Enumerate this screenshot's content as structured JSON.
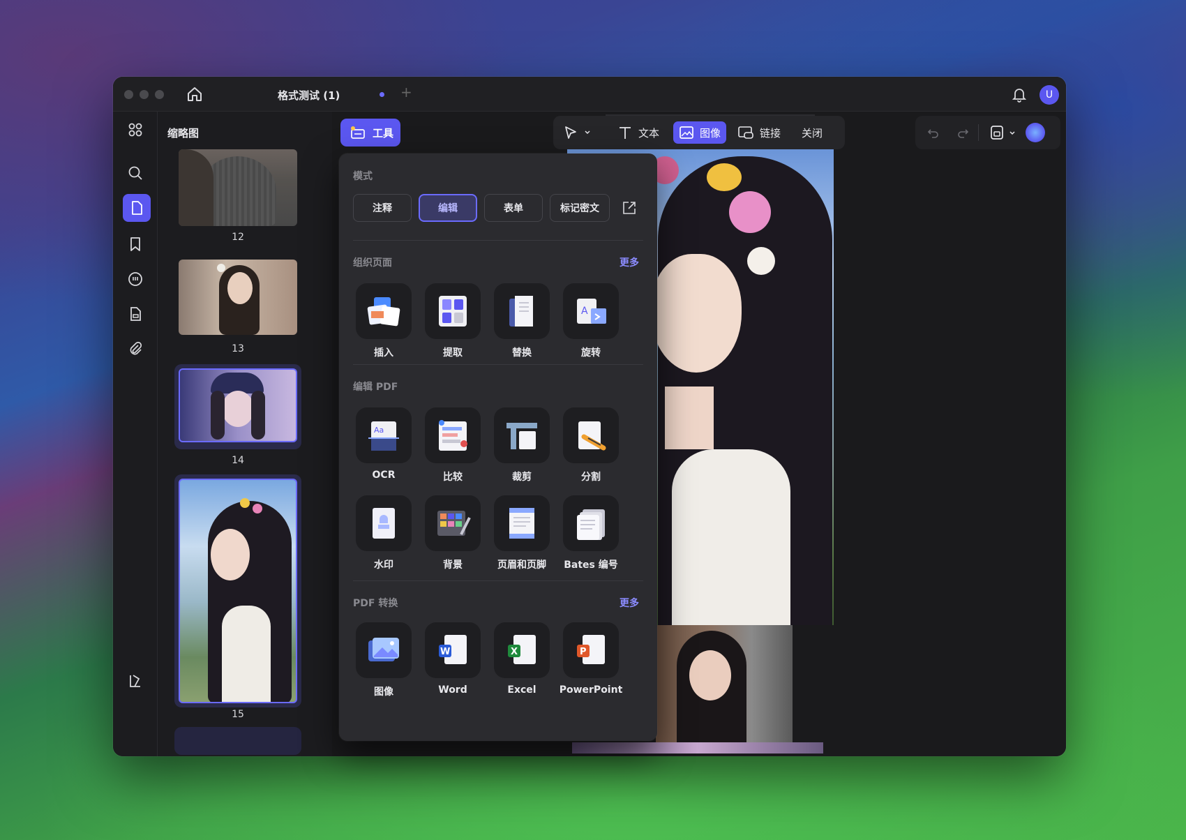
{
  "window": {
    "tab_title": "格式测试 (1)",
    "avatar_letter": "U"
  },
  "sidebar": {
    "panel_title": "缩略图",
    "rail_icons": [
      "grid-icon",
      "search-icon",
      "page-icon",
      "bookmark-icon",
      "comment-icon",
      "form-icon",
      "attachment-icon",
      "sidebar-toggle-icon"
    ],
    "thumbnails": [
      {
        "page": "12"
      },
      {
        "page": "13"
      },
      {
        "page": "14"
      },
      {
        "page": "15"
      }
    ]
  },
  "toolbar": {
    "tools_label": "工具",
    "text_label": "文本",
    "image_label": "图像",
    "link_label": "链接",
    "close_label": "关闭"
  },
  "popup": {
    "mode_title": "模式",
    "modes": [
      "注释",
      "编辑",
      "表单",
      "标记密文"
    ],
    "selected_mode": "编辑",
    "organize_title": "组织页面",
    "organize_more": "更多",
    "organize_tools": [
      "插入",
      "提取",
      "替换",
      "旋转"
    ],
    "edit_title": "编辑 PDF",
    "edit_tools": [
      "OCR",
      "比较",
      "裁剪",
      "分割",
      "水印",
      "背景",
      "页眉和页脚",
      "Bates 编号"
    ],
    "convert_title": "PDF 转换",
    "convert_more": "更多",
    "convert_tools": [
      "图像",
      "Word",
      "Excel",
      "PowerPoint"
    ]
  },
  "colors": {
    "accent": "#5b57f0",
    "window_bg": "#1c1c1f",
    "popup_bg": "#2b2b2f"
  }
}
